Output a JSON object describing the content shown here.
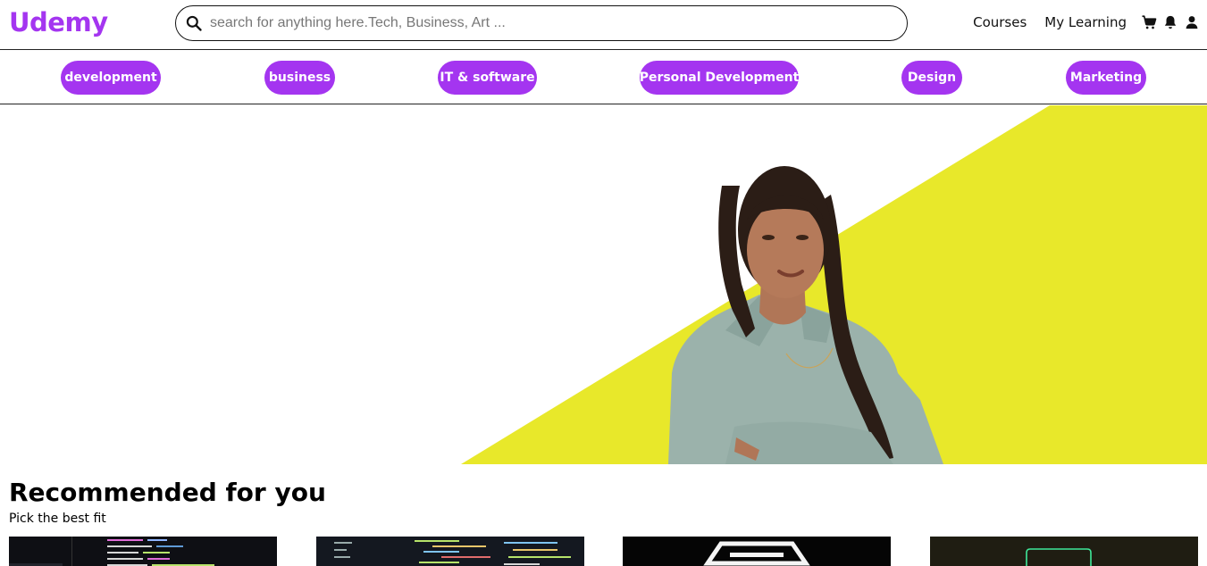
{
  "brand": {
    "name": "Udemy",
    "accent": "#a435f0",
    "hero_yellow": "#e8e82a"
  },
  "search": {
    "placeholder": "search for anything here.Tech, Business, Art ..."
  },
  "nav": {
    "courses": "Courses",
    "my_learning": "My Learning",
    "icons": [
      "cart-icon",
      "bell-icon",
      "user-icon"
    ]
  },
  "categories": [
    {
      "label": "development"
    },
    {
      "label": "business"
    },
    {
      "label": "IT & software"
    },
    {
      "label": "Personal Development"
    },
    {
      "label": "Design"
    },
    {
      "label": "Marketing"
    }
  ],
  "recommended": {
    "title": "Recommended for you",
    "subtitle": "Pick the best fit"
  },
  "cards": [
    {
      "thumb": "code-editor-thumbnail"
    },
    {
      "thumb": "code-screens-thumbnail"
    },
    {
      "thumb": "hexagon-light-thumbnail"
    },
    {
      "thumb": "laptop-neon-thumbnail"
    }
  ]
}
